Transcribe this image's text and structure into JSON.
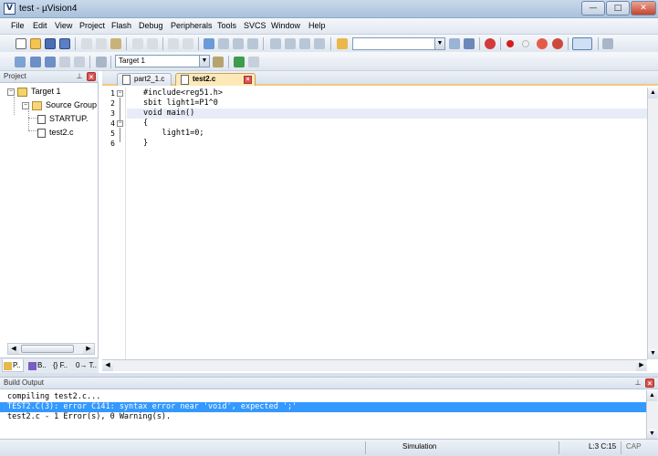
{
  "window": {
    "title": "test  - µVision4",
    "app_icon": "V",
    "controls": {
      "minimize": "—",
      "maximize": "□",
      "close": "✕"
    }
  },
  "menu": {
    "items": [
      "File",
      "Edit",
      "View",
      "Project",
      "Flash",
      "Debug",
      "Peripherals",
      "Tools",
      "SVCS",
      "Window",
      "Help"
    ]
  },
  "toolbar2": {
    "target_select": "Target 1"
  },
  "project_panel": {
    "title": "Project",
    "tree": {
      "target": "Target 1",
      "group": "Source Group",
      "files": [
        "STARTUP.",
        "test2.c"
      ]
    },
    "tabs": [
      "P..",
      "B..",
      "{} F..",
      "0→ T.."
    ]
  },
  "editor": {
    "tabs": [
      {
        "label": "part2_1.c",
        "active": false
      },
      {
        "label": "test2.c",
        "active": true
      }
    ],
    "lines": [
      {
        "num": "1",
        "text": "#include<reg51.h>"
      },
      {
        "num": "2",
        "text": "sbit light1=P1^0"
      },
      {
        "num": "3",
        "text": "void main()"
      },
      {
        "num": "4",
        "text": "{"
      },
      {
        "num": "5",
        "text": "    light1=0;"
      },
      {
        "num": "6",
        "text": "}"
      }
    ],
    "current_line": 3
  },
  "build_output": {
    "title": "Build Output",
    "lines": [
      {
        "text": "compiling test2.c...",
        "selected": false
      },
      {
        "text": "TEST2.C(3): error C141: syntax error near 'void', expected ';'",
        "selected": true
      },
      {
        "text": "test2.c - 1 Error(s), 0 Warning(s).",
        "selected": false
      }
    ]
  },
  "status": {
    "mode": "Simulation",
    "position": "L:3 C:15",
    "caps": "CAP"
  },
  "colors": {
    "selection": "#3399ff",
    "active_tab": "#fde9b8",
    "current_line": "#e8ecf8"
  }
}
